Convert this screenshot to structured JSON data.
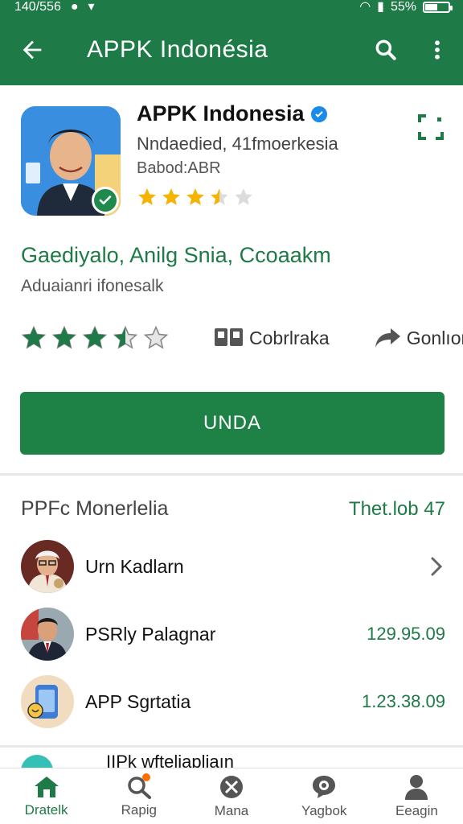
{
  "status_bar": {
    "time": "140/556",
    "battery": "55%",
    "battery_level": 0.55
  },
  "app_bar": {
    "title": "APPK Indonésia",
    "back_icon": "arrow-left-icon",
    "search_icon": "search-icon",
    "menu_icon": "more-vert-icon"
  },
  "app": {
    "name": "APPK Indonesia",
    "developer": "Nndaedied, 41fmoerkesia",
    "subtitle": "Babod:ABR",
    "rating_stars": 3.5,
    "tagline": "Gaediyalo, Anilg Snia, Ccoaakm",
    "tagline_sub": "Aduaianri ifonesalk",
    "meta_stars": 3.5,
    "meta_item_1": "Cobrlraka",
    "meta_item_2": "Gonlıorn",
    "install_label": "UNDA",
    "colors": {
      "primary": "#1e7a47",
      "button": "#1e8145",
      "star": "#f5b400"
    }
  },
  "list": {
    "title": "PPFc Monerlelia",
    "link": "Thet.lob 47",
    "rows": [
      {
        "label": "Urn Kadlarn",
        "value": ""
      },
      {
        "label": "PSRly Palagnar",
        "value": "129.95.09"
      },
      {
        "label": "APP Sgrtatia",
        "value": "1.23.38.09"
      }
    ],
    "peek_label": "IIPk wfteliapliaın"
  },
  "bottom_nav": [
    {
      "label": "Dratelk",
      "icon": "home-icon",
      "active": true
    },
    {
      "label": "Rapig",
      "icon": "search-icon",
      "active": false
    },
    {
      "label": "Mana",
      "icon": "compass-icon",
      "active": false
    },
    {
      "label": "Yagbok",
      "icon": "chat-icon",
      "active": false
    },
    {
      "label": "Eeagin",
      "icon": "person-icon",
      "active": false
    }
  ]
}
